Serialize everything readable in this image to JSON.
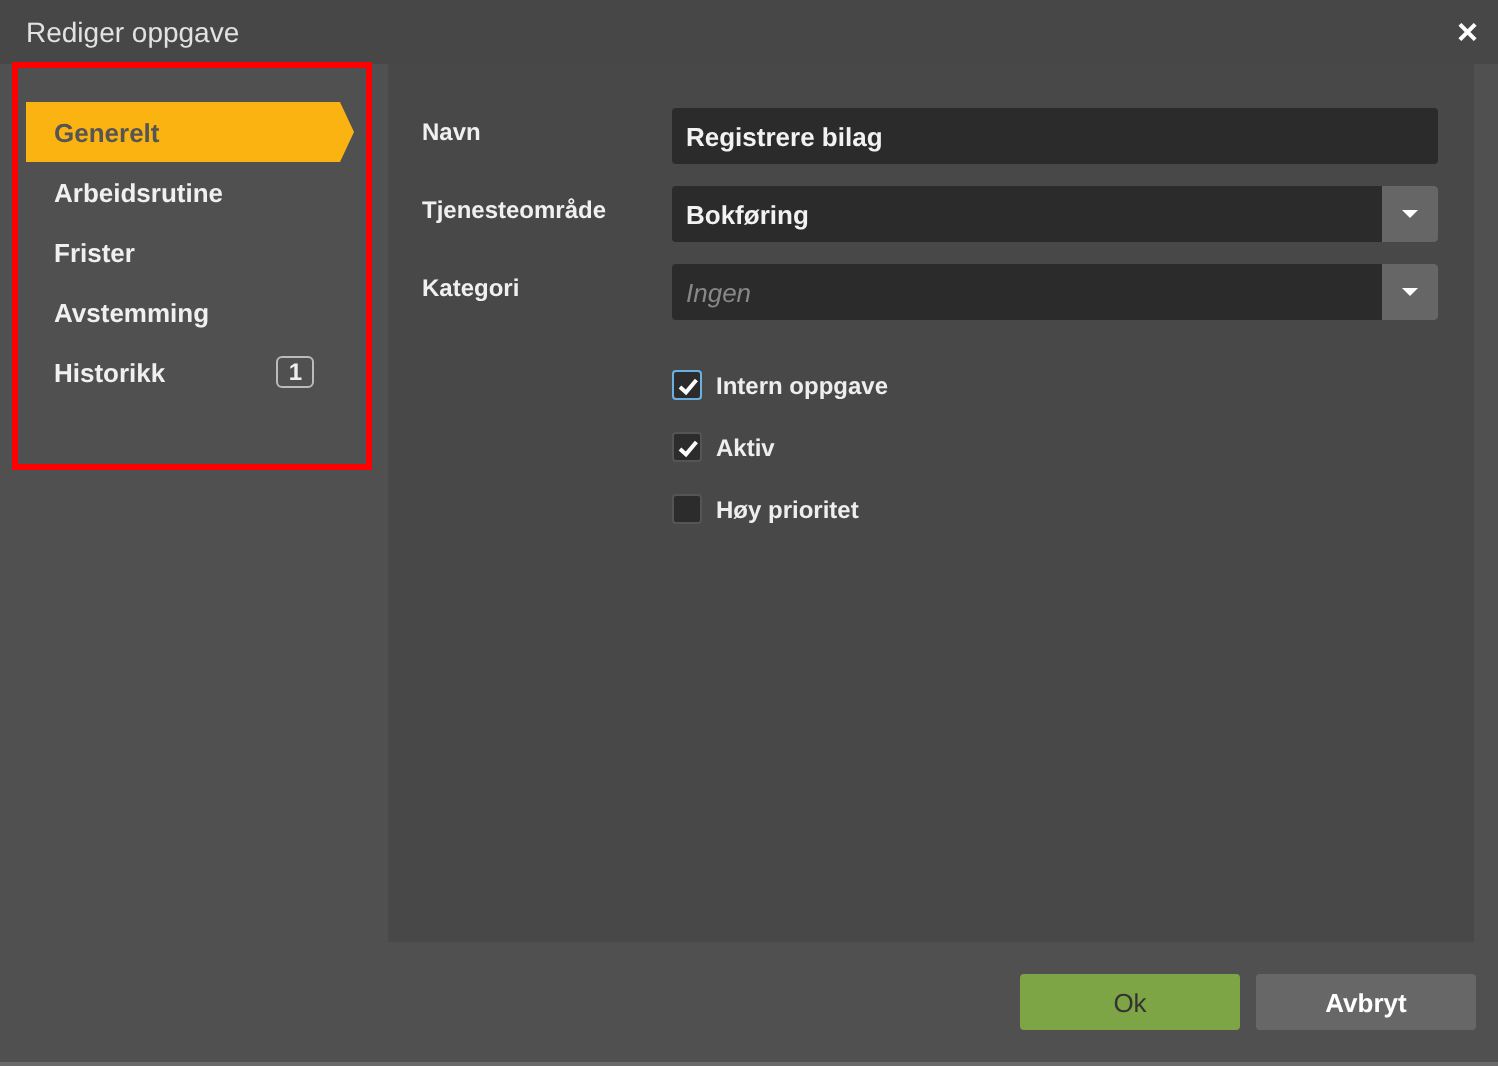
{
  "window": {
    "title": "Rediger oppgave",
    "close": "×"
  },
  "sidebar": {
    "highlighted": true,
    "items": [
      {
        "label": "Generelt",
        "selected": true
      },
      {
        "label": "Arbeidsrutine",
        "selected": false
      },
      {
        "label": "Frister",
        "selected": false
      },
      {
        "label": "Avstemming",
        "selected": false
      },
      {
        "label": "Historikk",
        "selected": false,
        "badge": "1"
      }
    ]
  },
  "form": {
    "fields": [
      {
        "kind": "text",
        "label": "Navn",
        "value": "Registrere bilag"
      },
      {
        "kind": "select",
        "label": "Tjenesteområde",
        "value": "Bokføring"
      },
      {
        "kind": "select",
        "label": "Kategori",
        "placeholder": "Ingen"
      }
    ],
    "checkboxes": [
      {
        "label": "Intern oppgave",
        "checked": true,
        "focused": true
      },
      {
        "label": "Aktiv",
        "checked": true,
        "focused": false
      },
      {
        "label": "Høy prioritet",
        "checked": false,
        "focused": false
      }
    ]
  },
  "buttons": [
    {
      "kind": "primary",
      "label": "Ok"
    },
    {
      "kind": "secondary",
      "label": "Avbryt"
    }
  ]
}
